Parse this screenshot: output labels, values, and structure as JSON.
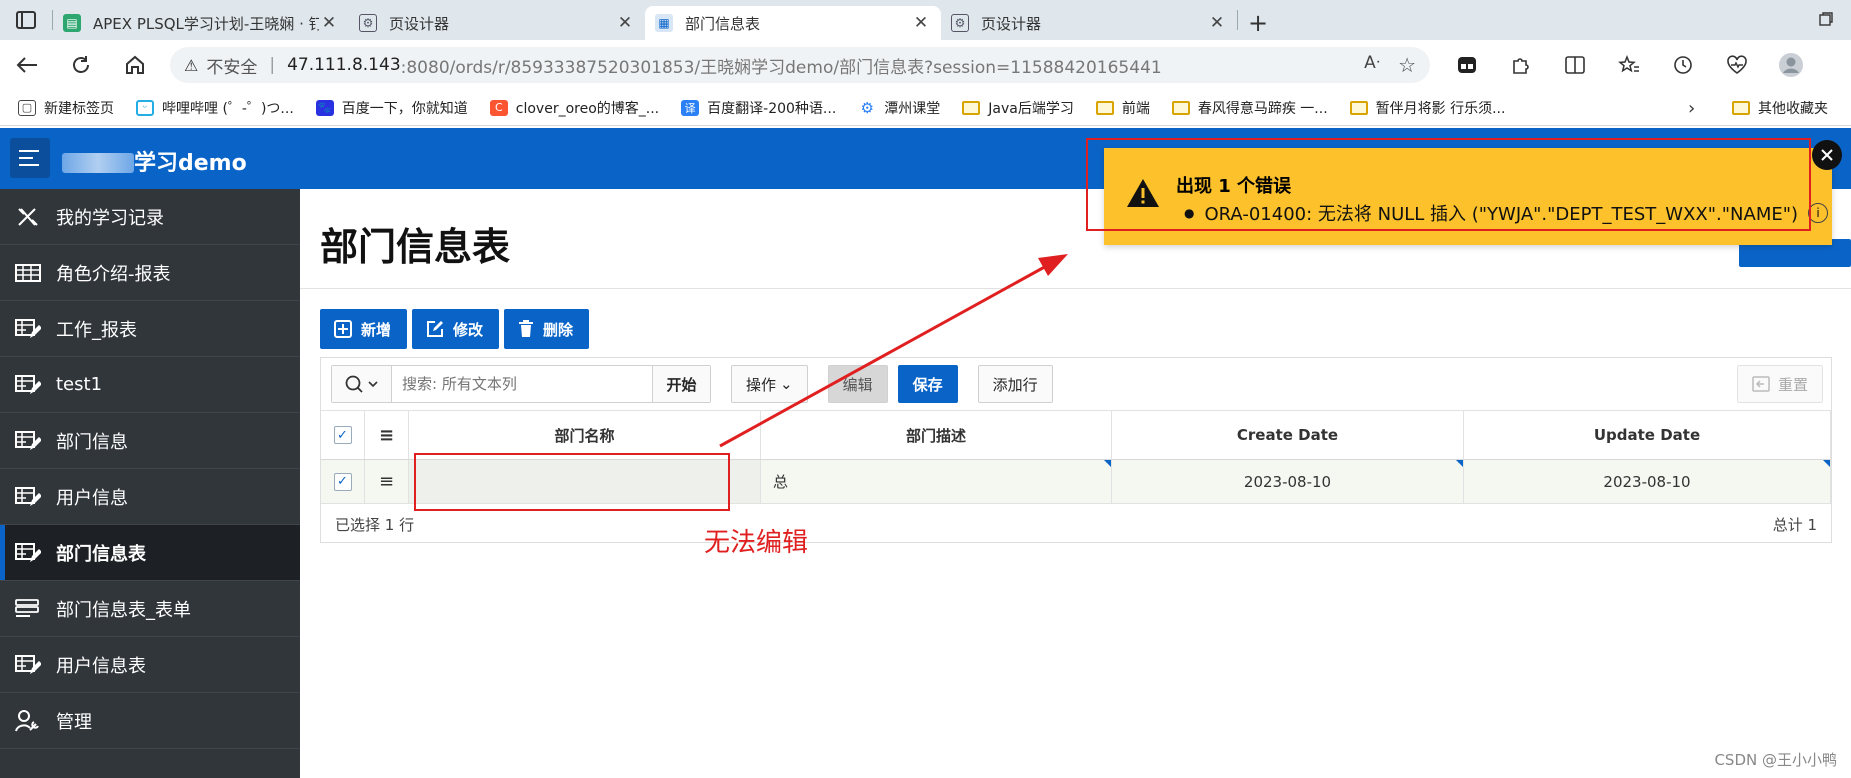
{
  "browser": {
    "tabs": [
      {
        "title": "APEX PLSQL学习计划-王晓娴 · 钉",
        "active": false
      },
      {
        "title": "页设计器",
        "active": false
      },
      {
        "title": "部门信息表",
        "active": true
      },
      {
        "title": "页设计器",
        "active": false
      }
    ],
    "url": {
      "insecure_label": "不安全",
      "separator": "|",
      "host": "47.111.8.143",
      "rest": ":8080/ords/r/85933387520301853/王晓娴学习demo/部门信息表?session=11588420165441"
    },
    "bookmarks": [
      {
        "label": "新建标签页",
        "icon": "page-icon"
      },
      {
        "label": "哔哩哔哩 (゜-゜)つ...",
        "icon": "bilibili-icon"
      },
      {
        "label": "百度一下，你就知道",
        "icon": "baidu-icon"
      },
      {
        "label": "clover_oreo的博客_...",
        "icon": "csdn-icon"
      },
      {
        "label": "百度翻译-200种语...",
        "icon": "translate-icon"
      },
      {
        "label": "潭州课堂",
        "icon": "gear-icon"
      },
      {
        "label": "Java后端学习",
        "icon": "folder-icon"
      },
      {
        "label": "前端",
        "icon": "folder-icon"
      },
      {
        "label": "春风得意马蹄疾 一...",
        "icon": "folder-icon"
      },
      {
        "label": "暂伴月将影 行乐须...",
        "icon": "folder-icon"
      }
    ],
    "bookmarks_other": "其他收藏夹"
  },
  "app": {
    "title_suffix": "学习demo",
    "nav": [
      {
        "label": "我的学习记录",
        "icon": "tools-icon",
        "active": false
      },
      {
        "label": "角色介绍-报表",
        "icon": "table-icon",
        "active": false
      },
      {
        "label": "工作_报表",
        "icon": "grid-edit-icon",
        "active": false
      },
      {
        "label": "test1",
        "icon": "grid-edit-icon",
        "active": false
      },
      {
        "label": "部门信息",
        "icon": "grid-edit-icon",
        "active": false
      },
      {
        "label": "用户信息",
        "icon": "grid-edit-icon",
        "active": false
      },
      {
        "label": "部门信息表",
        "icon": "grid-edit-icon",
        "active": true
      },
      {
        "label": "部门信息表_表单",
        "icon": "form-icon",
        "active": false
      },
      {
        "label": "用户信息表",
        "icon": "grid-edit-icon",
        "active": false
      },
      {
        "label": "管理",
        "icon": "user-wrench-icon",
        "active": false
      }
    ]
  },
  "page": {
    "title": "部门信息表",
    "toolbar": {
      "add": "新增",
      "edit": "修改",
      "delete": "删除"
    },
    "grid": {
      "search_placeholder": "搜索: 所有文本列",
      "go": "开始",
      "actions": "操作",
      "edit": "编辑",
      "save": "保存",
      "add_row": "添加行",
      "reset": "重置",
      "columns": [
        "部门名称",
        "部门描述",
        "Create Date",
        "Update Date"
      ],
      "rows": [
        {
          "name": "",
          "desc": "总",
          "create": "2023-08-10",
          "update": "2023-08-10"
        }
      ],
      "selected_text": "已选择 1 行",
      "total_text": "总计 1"
    }
  },
  "error": {
    "title": "出现 1 个错误",
    "message": "ORA-01400: 无法将 NULL 插入 (\"YWJA\".\"DEPT_TEST_WXX\".\"NAME\")"
  },
  "annotation": {
    "text": "无法编辑"
  },
  "watermark": "CSDN @王小小鸭",
  "colors": {
    "accent": "#0a64c8",
    "warning": "#fcc12b",
    "annotation": "#e02020",
    "sidebar": "#31363b"
  }
}
